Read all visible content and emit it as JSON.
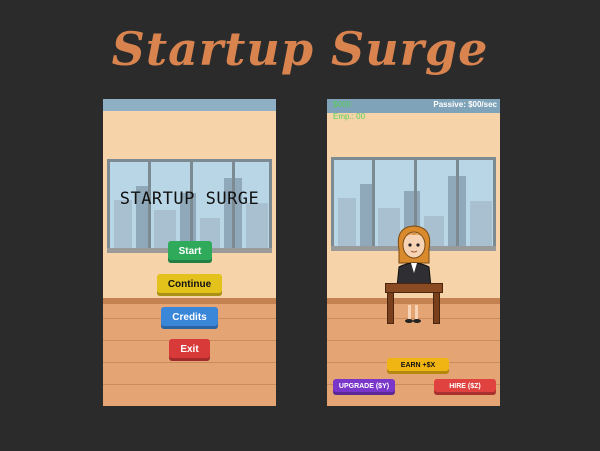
{
  "header": {
    "title": "Startup Surge"
  },
  "menu_screen": {
    "game_title": "STARTUP SURGE",
    "buttons": {
      "start": "Start",
      "continue": "Continue",
      "credits": "Credits",
      "exit": "Exit"
    }
  },
  "game_screen": {
    "hud": {
      "money": "$000",
      "passive": "Passive: $00/sec",
      "employees": "Emp.: 00"
    },
    "buttons": {
      "earn": "EARN +$X",
      "upgrade": "UPGRADE ($Y)",
      "hire": "HIRE ($Z)"
    }
  },
  "colors": {
    "background": "#2b2b2b",
    "title": "#d9844f",
    "start": "#2eaa5a",
    "continue": "#e3c21c",
    "credits": "#3a86d8",
    "exit": "#d83a3a",
    "earn": "#f0b413",
    "upgrade": "#7a36c9",
    "hire": "#e0423f",
    "hud_green": "#57d357"
  }
}
